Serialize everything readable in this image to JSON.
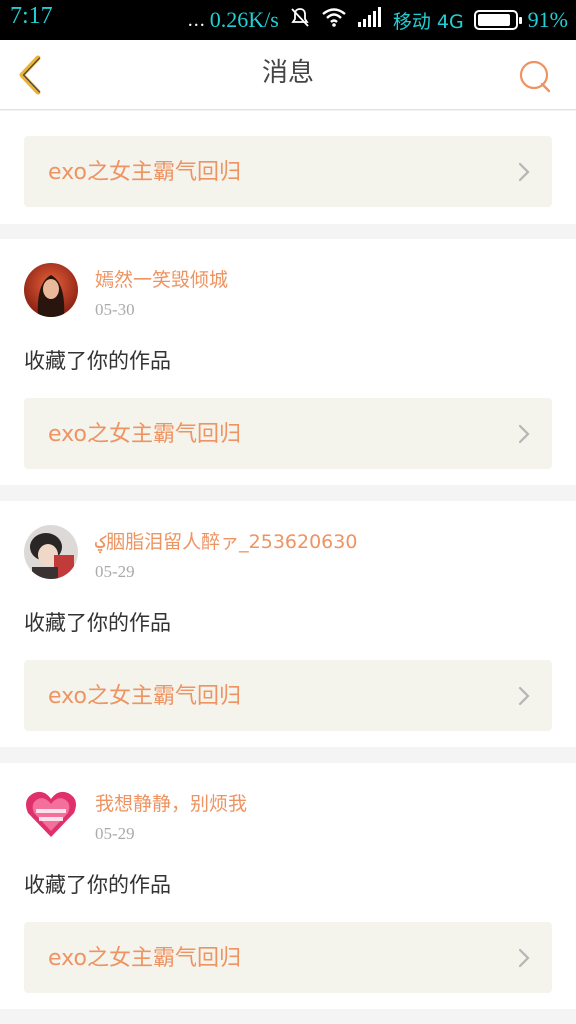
{
  "status_bar": {
    "time": "7:17",
    "dots": "...",
    "speed": "0.26K/s",
    "carrier": "移动 4G",
    "battery": "91%",
    "battery_level": 0.91
  },
  "header": {
    "title": "消息",
    "back_icon": "back-chevron-icon",
    "search_icon": "search-icon"
  },
  "first_card": {
    "title": "exo之女主霸气回归"
  },
  "messages": [
    {
      "username": "嫣然一笑毁倾城",
      "date": "05-30",
      "action": "收藏了你的作品",
      "work_title": "exo之女主霸气回归"
    },
    {
      "username": "ؼ胭脂泪留人醉ァ_253620630",
      "date": "05-29",
      "action": "收藏了你的作品",
      "work_title": "exo之女主霸气回归"
    },
    {
      "username": "我想静静，别烦我",
      "date": "05-29",
      "action": "收藏了你的作品",
      "work_title": "exo之女主霸气回归"
    }
  ],
  "colors": {
    "accent": "#ee9463",
    "card_bg": "#f4f3ec",
    "back_icon": "#e9b23a",
    "status_text": "#1fd1d6"
  }
}
